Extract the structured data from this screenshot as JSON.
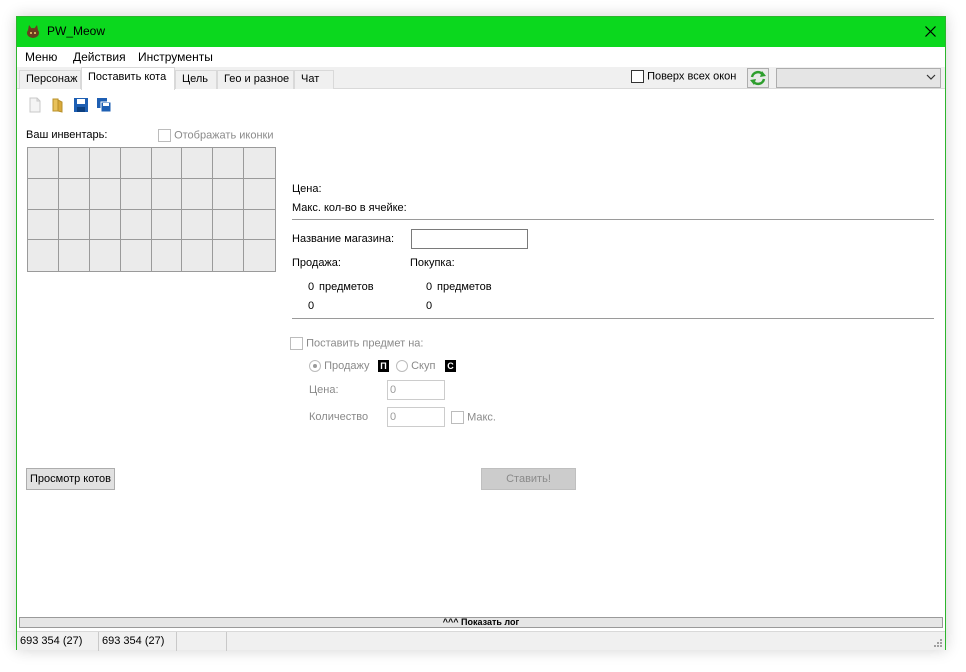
{
  "window": {
    "title": "PW_Meow"
  },
  "menu": [
    "Меню",
    "Действия",
    "Инструменты"
  ],
  "tabs": [
    "Персонаж",
    "Поставить кота",
    "Цель",
    "Гео и разное",
    "Чат"
  ],
  "active_tab": "Поставить кота",
  "topmost_label": "Поверх всех окон",
  "combo_value": "",
  "inventory": {
    "label": "Ваш инвентарь:",
    "show_icons_label": "Отображать иконки"
  },
  "info": {
    "price_label": "Цена:",
    "max_per_cell_label": "Макс. кол-во в ячейке:",
    "shop_name_label": "Название магазина:",
    "shop_name_value": "",
    "sell_label": "Продажа:",
    "buy_label": "Покупка:",
    "sell_count": "0",
    "sell_items_word": "предметов",
    "sell_sum": "0",
    "buy_count": "0",
    "buy_items_word": "предметов",
    "buy_sum": "0"
  },
  "place_item": {
    "label": "Поставить предмет на:",
    "sell_option": "Продажу",
    "sell_key": "П",
    "buy_option": "Скуп",
    "buy_key": "С",
    "price_label": "Цена:",
    "price_value": "0",
    "qty_label": "Количество",
    "qty_value": "0",
    "max_label": "Макс."
  },
  "buttons": {
    "view_cats": "Просмотр котов",
    "place": "Ставить!"
  },
  "log_toggle": "^^^ Показать лог",
  "status": [
    "693 354 (27)",
    "693 354 (27)",
    ""
  ]
}
